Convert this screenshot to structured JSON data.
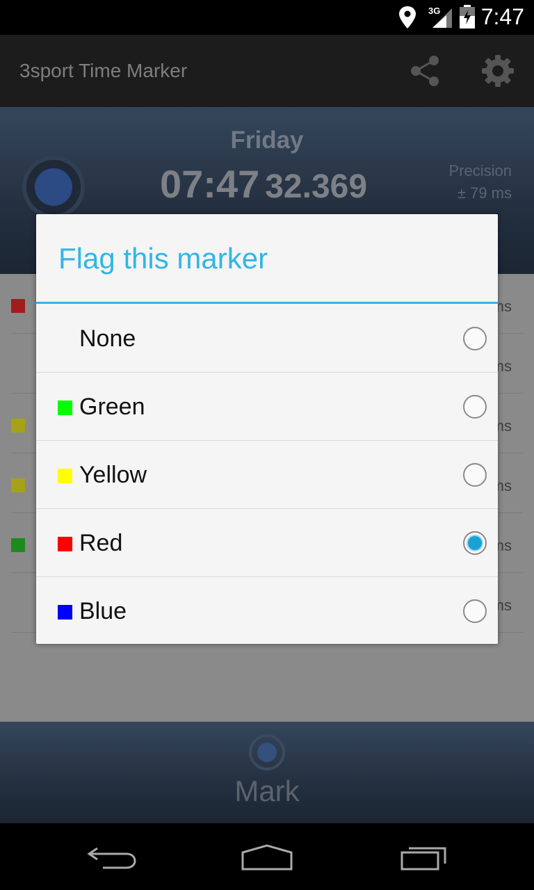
{
  "status_bar": {
    "time": "7:47",
    "network": "3G",
    "icons": [
      "location-icon",
      "signal-icon",
      "battery-icon"
    ]
  },
  "action_bar": {
    "title": "3sport Time Marker",
    "actions": [
      "share-icon",
      "gear-icon"
    ]
  },
  "header": {
    "day": "Friday",
    "time_main": "07:47",
    "time_ms": "32.369",
    "precision_label": "Precision",
    "precision_value": "± 79 ms"
  },
  "background_list": {
    "rows": [
      {
        "flag_color": "#a11d1d",
        "unit": "ms"
      },
      {
        "flag_color": null,
        "unit": "ms"
      },
      {
        "flag_color": "#a5a21a",
        "unit": "ms"
      },
      {
        "flag_color": "#a5a21a",
        "unit": "ms"
      },
      {
        "flag_color": "#1d8a1d",
        "unit": "ms"
      },
      {
        "flag_color": null,
        "unit": "ms"
      }
    ]
  },
  "dialog": {
    "title": "Flag this marker",
    "accent_color": "#33b5e5",
    "options": [
      {
        "label": "None",
        "color": null,
        "selected": false
      },
      {
        "label": "Green",
        "color": "#00ff00",
        "selected": false
      },
      {
        "label": "Yellow",
        "color": "#ffff00",
        "selected": false
      },
      {
        "label": "Red",
        "color": "#ff0000",
        "selected": true
      },
      {
        "label": "Blue",
        "color": "#0000ff",
        "selected": false
      }
    ]
  },
  "mark_panel": {
    "label": "Mark"
  },
  "nav_bar": {
    "buttons": [
      "back-icon",
      "home-icon",
      "recent-apps-icon"
    ]
  }
}
